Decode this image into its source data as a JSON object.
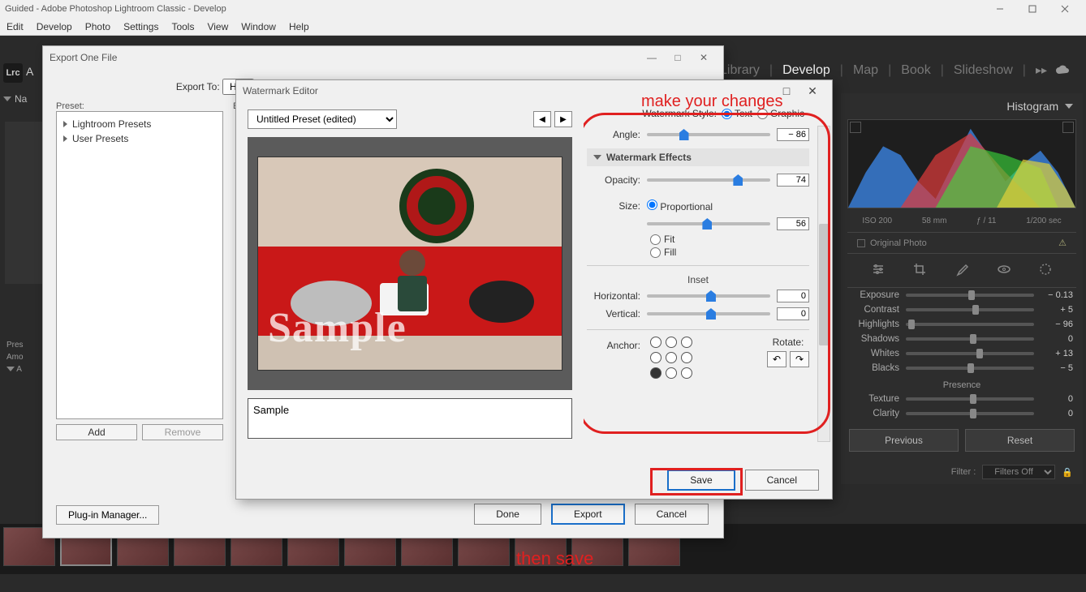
{
  "window": {
    "title": "Guided - Adobe Photoshop Lightroom Classic - Develop"
  },
  "menu": [
    "Edit",
    "Develop",
    "Photo",
    "Settings",
    "Tools",
    "View",
    "Window",
    "Help"
  ],
  "modules": {
    "items": [
      "Library",
      "Develop",
      "Map",
      "Book",
      "Slideshow"
    ],
    "active": "Develop"
  },
  "left_nav_label": "Na",
  "logo_text": "Lrc",
  "adobe_label": "A",
  "left_panel": {
    "rows": [
      "Pres",
      "Amo",
      "A"
    ]
  },
  "right_panel": {
    "title": "Histogram",
    "meta": {
      "iso": "ISO 200",
      "focal": "58 mm",
      "fstop": "ƒ / 11",
      "shutter": "1/200 sec"
    },
    "original_photo": "Original Photo",
    "sliders": [
      {
        "label": "Exposure",
        "pos": 49,
        "val": "− 0.13"
      },
      {
        "label": "Contrast",
        "pos": 52,
        "val": "+ 5"
      },
      {
        "label": "Highlights",
        "pos": 2,
        "val": "− 96"
      },
      {
        "label": "Shadows",
        "pos": 50,
        "val": "0"
      },
      {
        "label": "Whites",
        "pos": 55,
        "val": "+ 13"
      },
      {
        "label": "Blacks",
        "pos": 48,
        "val": "− 5"
      }
    ],
    "presence_label": "Presence",
    "presence": [
      {
        "label": "Texture",
        "pos": 50,
        "val": "0"
      },
      {
        "label": "Clarity",
        "pos": 50,
        "val": "0"
      }
    ],
    "buttons": {
      "prev": "Previous",
      "reset": "Reset"
    },
    "filter_label": "Filter :",
    "filter_value": "Filters Off"
  },
  "export": {
    "title": "Export One File",
    "export_to_label": "Export To:",
    "export_to_value": "H",
    "preset_label": "Preset:",
    "right_stub": "Ex",
    "presets": [
      "Lightroom Presets",
      "User Presets"
    ],
    "add": "Add",
    "remove": "Remove",
    "plugin": "Plug-in Manager...",
    "done": "Done",
    "export_btn": "Export",
    "cancel": "Cancel"
  },
  "watermark": {
    "title": "Watermark Editor",
    "preset": "Untitled Preset (edited)",
    "style_label": "Watermark Style:",
    "style_text": "Text",
    "style_graphic": "Graphic",
    "angle_label": "Angle:",
    "angle_val": "− 86",
    "effects_head": "Watermark Effects",
    "opacity_label": "Opacity:",
    "opacity_val": "74",
    "size_label": "Size:",
    "size_prop": "Proportional",
    "size_val": "56",
    "size_fit": "Fit",
    "size_fill": "Fill",
    "inset_head": "Inset",
    "horiz_label": "Horizontal:",
    "horiz_val": "0",
    "vert_label": "Vertical:",
    "vert_val": "0",
    "anchor_label": "Anchor:",
    "rotate_label": "Rotate:",
    "sample_text": "Sample",
    "text_area": "Sample",
    "save": "Save",
    "cancel": "Cancel"
  },
  "annotations": {
    "changes": "make your changes",
    "save": "then save"
  }
}
